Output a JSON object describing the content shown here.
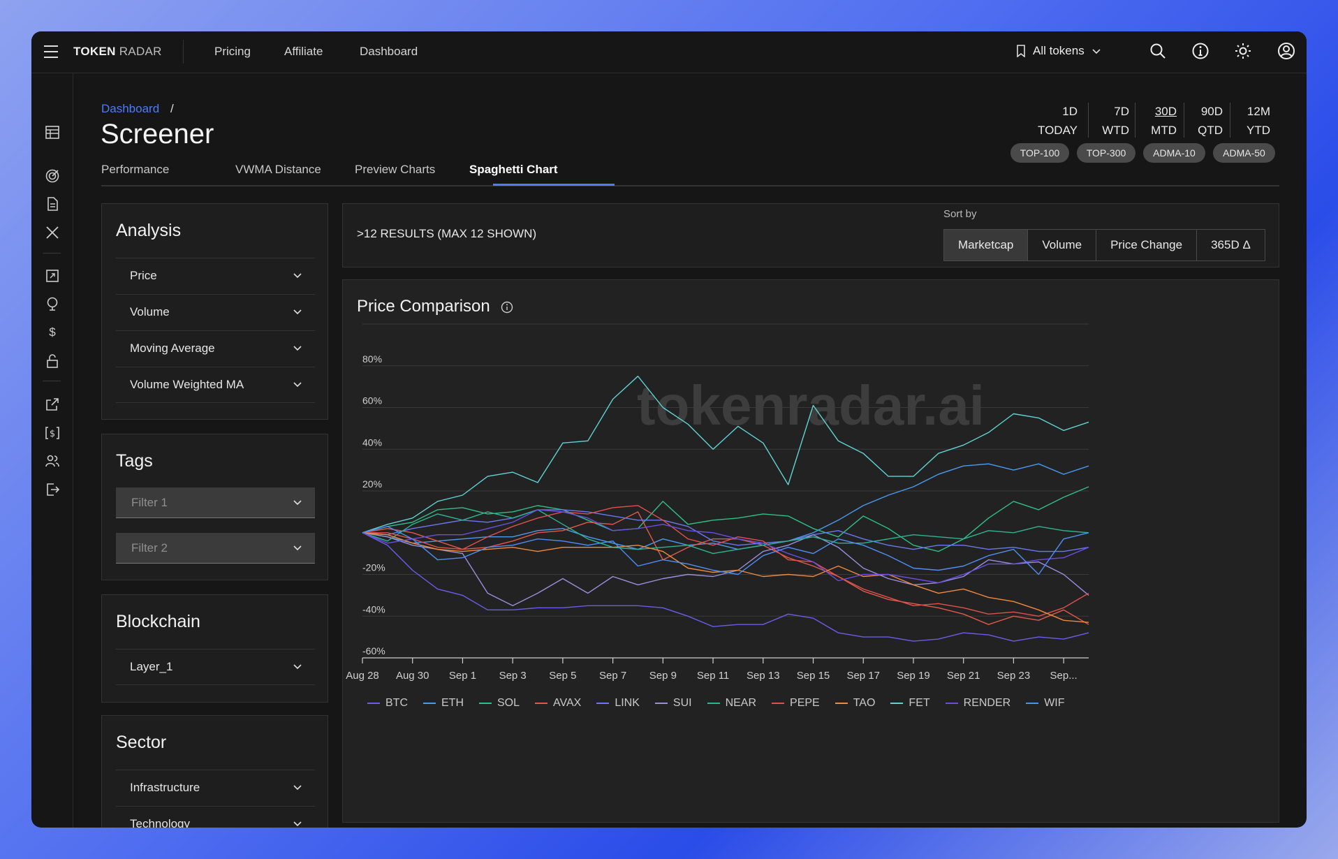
{
  "app": {
    "logo_bold": "TOKEN",
    "logo_light": "RADAR"
  },
  "nav": {
    "items": [
      "Pricing",
      "Affiliate",
      "Dashboard"
    ]
  },
  "token_selector": {
    "label": "All tokens"
  },
  "breadcrumb": {
    "link": "Dashboard",
    "sep": "/"
  },
  "page_title": "Screener",
  "tabs": [
    "Performance",
    "VWMA Distance",
    "Preview Charts",
    "Spaghetti Chart"
  ],
  "active_tab": "Spaghetti Chart",
  "periods": [
    {
      "top": "1D",
      "bottom": "TODAY"
    },
    {
      "top": "7D",
      "bottom": "WTD"
    },
    {
      "top": "30D",
      "bottom": "MTD",
      "active": true
    },
    {
      "top": "90D",
      "bottom": "QTD"
    },
    {
      "top": "12M",
      "bottom": "YTD"
    }
  ],
  "pills": [
    "TOP-100",
    "TOP-300",
    "ADMA-10",
    "ADMA-50"
  ],
  "analysis": {
    "title": "Analysis",
    "items": [
      "Price",
      "Volume",
      "Moving Average",
      "Volume Weighted MA"
    ]
  },
  "tags": {
    "title": "Tags",
    "filters": [
      "Filter 1",
      "Filter 2"
    ]
  },
  "blockchain": {
    "title": "Blockchain",
    "items": [
      "Layer_1"
    ]
  },
  "sector": {
    "title": "Sector",
    "items": [
      "Infrastructure",
      "Technology"
    ]
  },
  "results": {
    "count": ">12 RESULTS (MAX 12 SHOWN)",
    "sort_label": "Sort by",
    "sort_options": [
      "Marketcap",
      "Volume",
      "Price Change",
      "365D Δ"
    ],
    "active_sort": "Marketcap"
  },
  "chart_title": "Price Comparison",
  "watermark": "tokenradar.ai",
  "colors": {
    "accent": "#4d7cf5",
    "background": "#161616",
    "panel": "#1e1e1e"
  },
  "chart_data": {
    "type": "line",
    "title": "Price Comparison",
    "xlabel": "",
    "ylabel": "",
    "ylim": [
      -60,
      100
    ],
    "y_ticks": [
      "80%",
      "60%",
      "40%",
      "20%",
      "-20%",
      "-40%",
      "-60%"
    ],
    "y_tick_values": [
      80,
      60,
      40,
      20,
      -20,
      -40,
      -60
    ],
    "x_ticks": [
      "Aug 28",
      "Aug 30",
      "Sep 1",
      "Sep 3",
      "Sep 5",
      "Sep 7",
      "Sep 9",
      "Sep 11",
      "Sep 13",
      "Sep 15",
      "Sep 17",
      "Sep 19",
      "Sep 21",
      "Sep 23",
      "Sep..."
    ],
    "grid": true,
    "legend_position": "bottom-left",
    "x_count": 30,
    "series": [
      {
        "name": "BTC",
        "color": "#6a5ee8",
        "values": [
          0,
          -6,
          -18,
          -27,
          -30,
          -37,
          -37,
          -36,
          -36,
          -35,
          -35,
          -35,
          -36,
          -40,
          -45,
          -44,
          -44,
          -39,
          -41,
          -48,
          -50,
          -50,
          -52,
          -51,
          -48,
          -49,
          -52,
          -50,
          -51,
          -48
        ]
      },
      {
        "name": "ETH",
        "color": "#4a9af0",
        "values": [
          0,
          -2,
          -5,
          -4,
          -3,
          -2,
          -2,
          1,
          2,
          -2,
          -5,
          -8,
          -3,
          -6,
          -5,
          -8,
          -6,
          -4,
          0,
          6,
          13,
          18,
          22,
          28,
          32,
          33,
          30,
          33,
          28,
          32
        ]
      },
      {
        "name": "SOL",
        "color": "#2fbf89",
        "values": [
          0,
          3,
          5,
          11,
          12,
          9,
          10,
          13,
          11,
          6,
          1,
          2,
          15,
          4,
          6,
          7,
          9,
          8,
          2,
          -2,
          8,
          2,
          -6,
          -9,
          -3,
          7,
          15,
          11,
          17,
          22
        ]
      },
      {
        "name": "AVAX",
        "color": "#e05a4a",
        "values": [
          0,
          2,
          0,
          -4,
          -8,
          -7,
          -4,
          0,
          1,
          5,
          4,
          10,
          -13,
          -7,
          -3,
          -3,
          -6,
          -12,
          -16,
          -21,
          -28,
          -32,
          -34,
          -36,
          -39,
          -44,
          -40,
          -42,
          -37,
          -44
        ]
      },
      {
        "name": "LINK",
        "color": "#6b78f2",
        "values": [
          0,
          -1,
          2,
          4,
          6,
          5,
          7,
          11,
          11,
          10,
          8,
          6,
          6,
          3,
          -4,
          -6,
          -5,
          -4,
          -1,
          1,
          -3,
          -6,
          -8,
          -6,
          -6,
          -8,
          -7,
          -9,
          -9,
          -7
        ]
      },
      {
        "name": "SUI",
        "color": "#9a8fdb",
        "values": [
          0,
          -2,
          -6,
          -8,
          -10,
          -29,
          -35,
          -29,
          -22,
          -29,
          -21,
          -25,
          -22,
          -20,
          -21,
          -18,
          -9,
          -6,
          -1,
          -7,
          -17,
          -22,
          -25,
          -24,
          -21,
          -13,
          -15,
          -14,
          -20,
          -30
        ]
      },
      {
        "name": "NEAR",
        "color": "#2bb592",
        "values": [
          0,
          -4,
          4,
          9,
          6,
          10,
          7,
          11,
          4,
          -3,
          -7,
          -8,
          -7,
          -6,
          -10,
          -8,
          -6,
          -4,
          -2,
          -5,
          -5,
          -3,
          -1,
          -2,
          -3,
          1,
          0,
          3,
          1,
          0
        ]
      },
      {
        "name": "PEPE",
        "color": "#e0504c",
        "values": [
          0,
          0,
          -3,
          -7,
          -8,
          -2,
          3,
          7,
          10,
          9,
          12,
          13,
          6,
          -3,
          -6,
          -2,
          -4,
          -13,
          -14,
          -21,
          -27,
          -31,
          -35,
          -34,
          -36,
          -39,
          -38,
          -40,
          -36,
          -29
        ]
      },
      {
        "name": "TAO",
        "color": "#f08a3c",
        "values": [
          0,
          -1,
          -5,
          -8,
          -9,
          -8,
          -7,
          -9,
          -7,
          -7,
          -7,
          -6,
          -9,
          -17,
          -19,
          -18,
          -21,
          -20,
          -21,
          -16,
          -21,
          -20,
          -25,
          -29,
          -27,
          -31,
          -33,
          -37,
          -42,
          -43
        ]
      },
      {
        "name": "FET",
        "color": "#5fd3d5",
        "values": [
          0,
          4,
          7,
          15,
          18,
          27,
          29,
          24,
          43,
          44,
          64,
          75,
          60,
          52,
          40,
          51,
          43,
          23,
          61,
          44,
          38,
          27,
          27,
          38,
          42,
          48,
          57,
          55,
          49,
          53
        ]
      },
      {
        "name": "RENDER",
        "color": "#6a4ee0",
        "values": [
          0,
          -5,
          -3,
          -1,
          -1,
          2,
          5,
          11,
          10,
          7,
          1,
          2,
          4,
          1,
          0,
          -3,
          -5,
          -10,
          -14,
          -23,
          -20,
          -20,
          -22,
          -24,
          -20,
          -15,
          -15,
          -13,
          -12,
          -7
        ]
      },
      {
        "name": "WIF",
        "color": "#4f8ef5",
        "values": [
          0,
          3,
          -3,
          -13,
          -12,
          -7,
          -6,
          -3,
          -4,
          -6,
          -4,
          -16,
          -13,
          -15,
          -18,
          -20,
          -11,
          -7,
          -10,
          -3,
          -6,
          -11,
          -17,
          -18,
          -16,
          -11,
          -8,
          -20,
          -3,
          0
        ]
      }
    ]
  }
}
